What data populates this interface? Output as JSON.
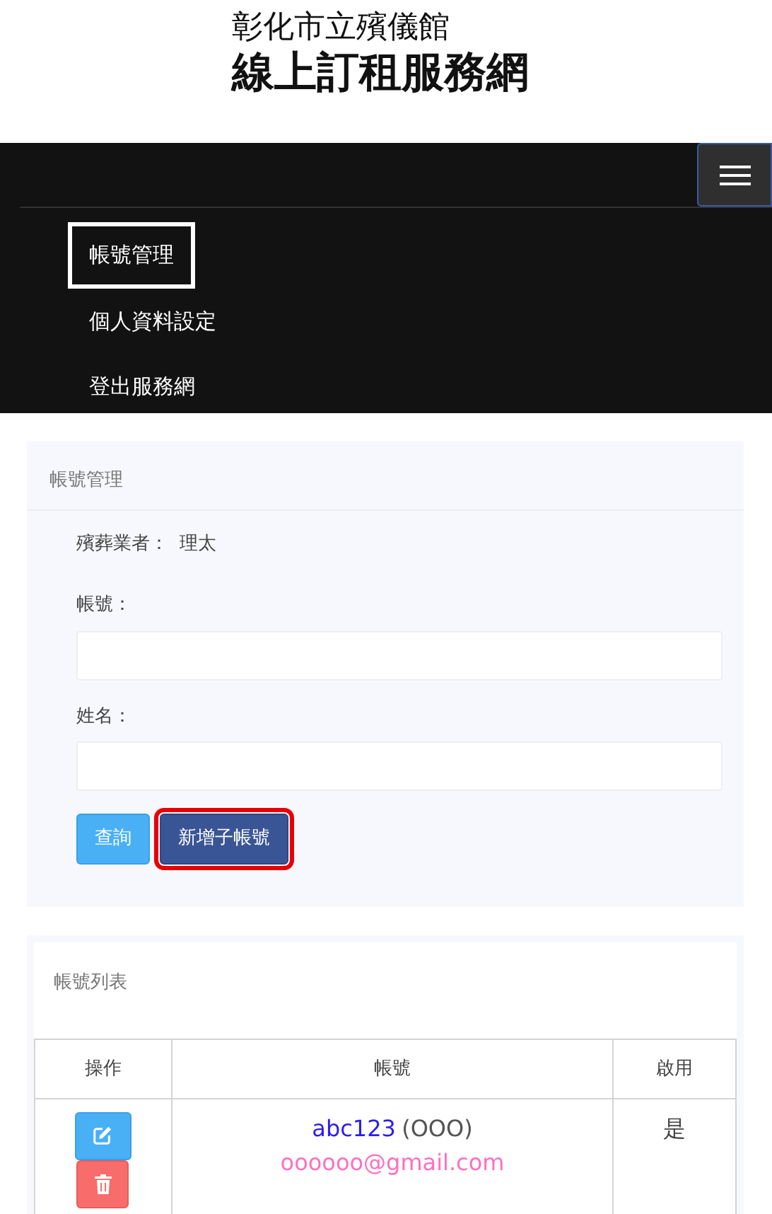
{
  "header": {
    "subtitle": "彰化市立殯儀館",
    "title": "線上訂租服務網"
  },
  "navbar": {
    "expanded": true,
    "items": [
      {
        "label": "帳號管理",
        "selected": true
      },
      {
        "label": "個人資料設定",
        "selected": false
      },
      {
        "label": "登出服務網",
        "selected": false
      }
    ]
  },
  "search_card": {
    "title": "帳號管理",
    "vendor_label": "殯葬業者：",
    "vendor_value": "理太",
    "fields": [
      {
        "label": "帳號："
      },
      {
        "label": "姓名："
      }
    ],
    "buttons": [
      {
        "label": "查詢",
        "kind": "query",
        "highlighted": false
      },
      {
        "label": "新增子帳號",
        "kind": "add",
        "highlighted": true
      }
    ]
  },
  "list_card": {
    "title": "帳號列表",
    "columns": [
      "操作",
      "帳號",
      "啟用"
    ],
    "rows": [
      {
        "account": "abc123",
        "name": "(OOO)",
        "email": "oooooo@gmail.com",
        "enabled": "是"
      }
    ]
  }
}
